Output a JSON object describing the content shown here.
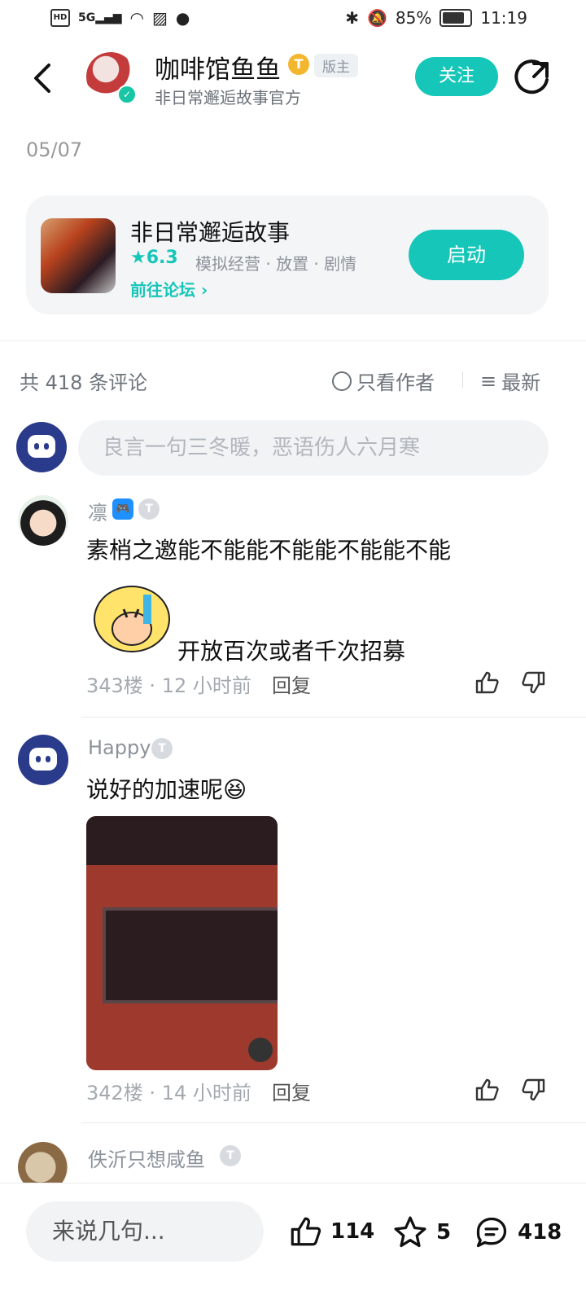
{
  "status": {
    "left_icons": [
      "HD",
      "5G",
      "signal",
      "wifi",
      "image",
      "wechat"
    ],
    "battery": "85%",
    "time": "11:19"
  },
  "header": {
    "author_name": "咖啡馆鱼鱼",
    "author_level": "T",
    "role_badge": "版主",
    "subtitle": "非日常邂逅故事官方",
    "follow_label": "关注"
  },
  "post": {
    "date": "05/07"
  },
  "game_card": {
    "title": "非日常邂逅故事",
    "rating": "6.3",
    "genres": "模拟经营 · 放置 · 剧情",
    "forum_link": "前往论坛",
    "launch_label": "启动"
  },
  "comments_bar": {
    "count_text": "共 418 条评论",
    "filter_author": "只看作者",
    "sort_label": "最新"
  },
  "comment_input": {
    "placeholder": "良言一句三冬暖，恶语伤人六月寒"
  },
  "comments": [
    {
      "name": "凛",
      "level": "T",
      "text": "素梢之邀能不能能不能能不能能不能",
      "sticker_caption": "开放百次或者千次招募",
      "floor": "343楼 · 12 小时前",
      "reply": "回复"
    },
    {
      "name": "Happy",
      "level": "T",
      "text": "说好的加速呢",
      "emoji": "😆",
      "floor": "342楼 · 14 小时前",
      "reply": "回复"
    },
    {
      "name": "佚沂只想咸鱼",
      "level": "T"
    }
  ],
  "bottom_bar": {
    "input_placeholder": "来说几句...",
    "likes": "114",
    "favorites": "5",
    "comments": "418"
  }
}
